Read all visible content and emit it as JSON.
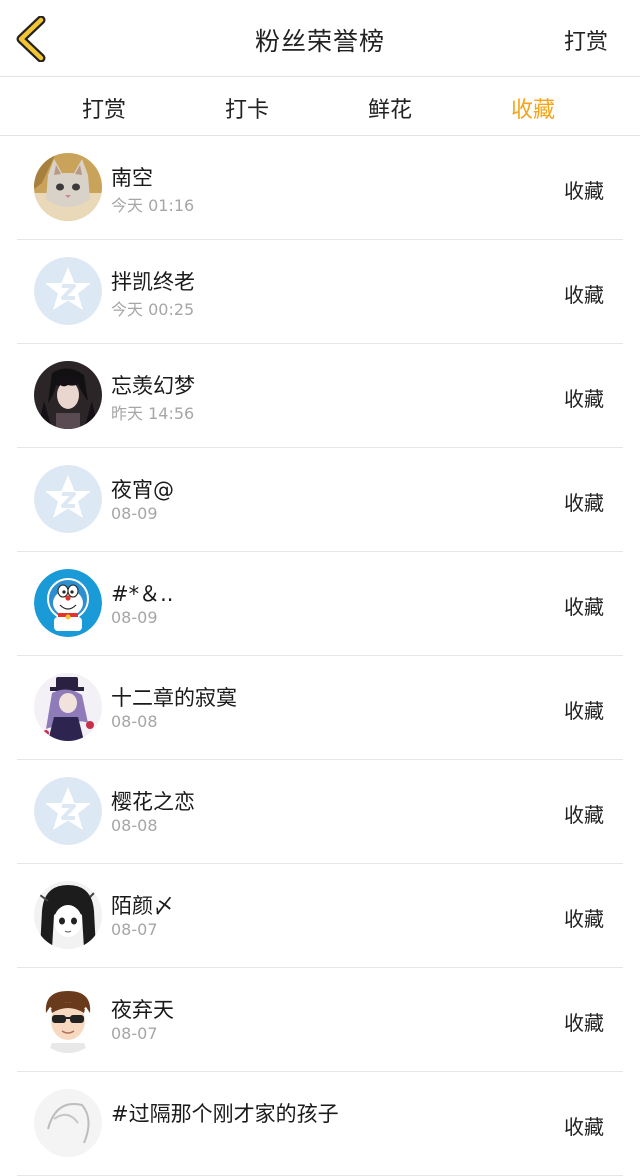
{
  "header": {
    "title": "粉丝荣誉榜",
    "right_action": "打赏",
    "accent_color": "#f4a51c"
  },
  "tabs": [
    {
      "label": "打赏",
      "active": false
    },
    {
      "label": "打卡",
      "active": false
    },
    {
      "label": "鲜花",
      "active": false
    },
    {
      "label": "收藏",
      "active": true
    }
  ],
  "list": [
    {
      "name": "南空",
      "time": "今天 01:16",
      "action": "收藏",
      "avatar": "cat-photo"
    },
    {
      "name": "拌凯终老",
      "time": "今天 00:25",
      "action": "收藏",
      "avatar": "default-star"
    },
    {
      "name": "忘羡幻梦",
      "time": "昨天 14:56",
      "action": "收藏",
      "avatar": "dark-anime"
    },
    {
      "name": "夜宵@",
      "time": "08-09",
      "action": "收藏",
      "avatar": "default-star"
    },
    {
      "name": "#*＆..",
      "time": "08-09",
      "action": "收藏",
      "avatar": "doraemon"
    },
    {
      "name": "十二章的寂寞",
      "time": "08-08",
      "action": "收藏",
      "avatar": "purple-anime"
    },
    {
      "name": "樱花之恋",
      "time": "08-08",
      "action": "收藏",
      "avatar": "default-star"
    },
    {
      "name": "陌颜〆",
      "time": "08-07",
      "action": "收藏",
      "avatar": "manga-girl"
    },
    {
      "name": "夜弃天",
      "time": "08-07",
      "action": "收藏",
      "avatar": "cartoon-boy"
    },
    {
      "name": "#过隔那个刚才家的孩子",
      "time": "",
      "action": "收藏",
      "avatar": "sketch"
    }
  ]
}
